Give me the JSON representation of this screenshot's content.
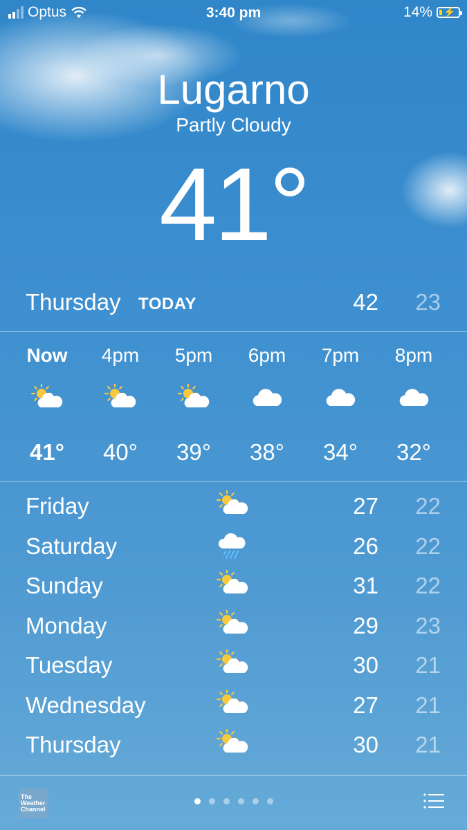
{
  "status_bar": {
    "carrier": "Optus",
    "time": "3:40 pm",
    "battery": "14%"
  },
  "location": {
    "city": "Lugarno",
    "condition": "Partly Cloudy",
    "temperature": "41°"
  },
  "today": {
    "day": "Thursday",
    "tag": "TODAY",
    "high": "42",
    "low": "23"
  },
  "hourly": [
    {
      "time": "Now",
      "icon": "partly-cloudy-icon",
      "temp": "41°"
    },
    {
      "time": "4pm",
      "icon": "partly-cloudy-icon",
      "temp": "40°"
    },
    {
      "time": "5pm",
      "icon": "partly-cloudy-icon",
      "temp": "39°"
    },
    {
      "time": "6pm",
      "icon": "cloud-icon",
      "temp": "38°"
    },
    {
      "time": "7pm",
      "icon": "cloud-icon",
      "temp": "34°"
    },
    {
      "time": "8pm",
      "icon": "cloud-icon",
      "temp": "32°"
    }
  ],
  "daily": [
    {
      "day": "Friday",
      "icon": "partly-cloudy-icon",
      "high": "27",
      "low": "22"
    },
    {
      "day": "Saturday",
      "icon": "rain-icon",
      "high": "26",
      "low": "22"
    },
    {
      "day": "Sunday",
      "icon": "partly-cloudy-icon",
      "high": "31",
      "low": "22"
    },
    {
      "day": "Monday",
      "icon": "partly-cloudy-icon",
      "high": "29",
      "low": "23"
    },
    {
      "day": "Tuesday",
      "icon": "partly-cloudy-icon",
      "high": "30",
      "low": "21"
    },
    {
      "day": "Wednesday",
      "icon": "partly-cloudy-icon",
      "high": "27",
      "low": "21"
    },
    {
      "day": "Thursday",
      "icon": "partly-cloudy-icon",
      "high": "30",
      "low": "21"
    }
  ],
  "bottom_bar": {
    "logo_text": "The Weather Channel",
    "page_count": 6,
    "active_page": 1
  },
  "colors": {
    "sun": "#f7c93e",
    "low_temp": "rgba(255,255,255,0.55)"
  }
}
